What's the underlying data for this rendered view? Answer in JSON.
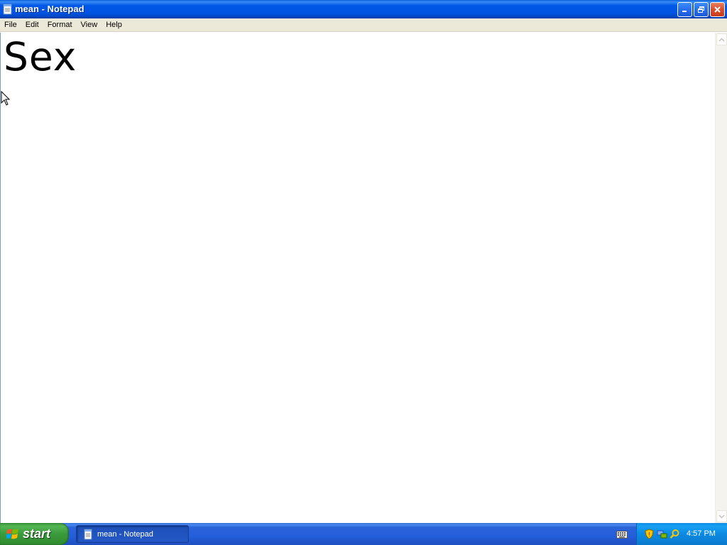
{
  "window": {
    "title": "mean - Notepad",
    "icon": "notepad-icon"
  },
  "titlebar_buttons": {
    "minimize_icon": "minimize-icon",
    "maximize_icon": "restore-icon",
    "close_icon": "close-icon"
  },
  "menu": {
    "items": [
      {
        "label": "File"
      },
      {
        "label": "Edit"
      },
      {
        "label": "Format"
      },
      {
        "label": "View"
      },
      {
        "label": "Help"
      }
    ]
  },
  "editor": {
    "content": "Sex"
  },
  "taskbar": {
    "start_label": "start",
    "task_label": "mean - Notepad",
    "clock": "4:57 PM"
  },
  "colors": {
    "titlebar_blue": "#0054e3",
    "taskbar_blue": "#245edb",
    "start_green": "#3b9a3b",
    "tray_blue": "#0c8ae3",
    "close_red": "#d94e2c",
    "menu_gray": "#ece9d8"
  }
}
